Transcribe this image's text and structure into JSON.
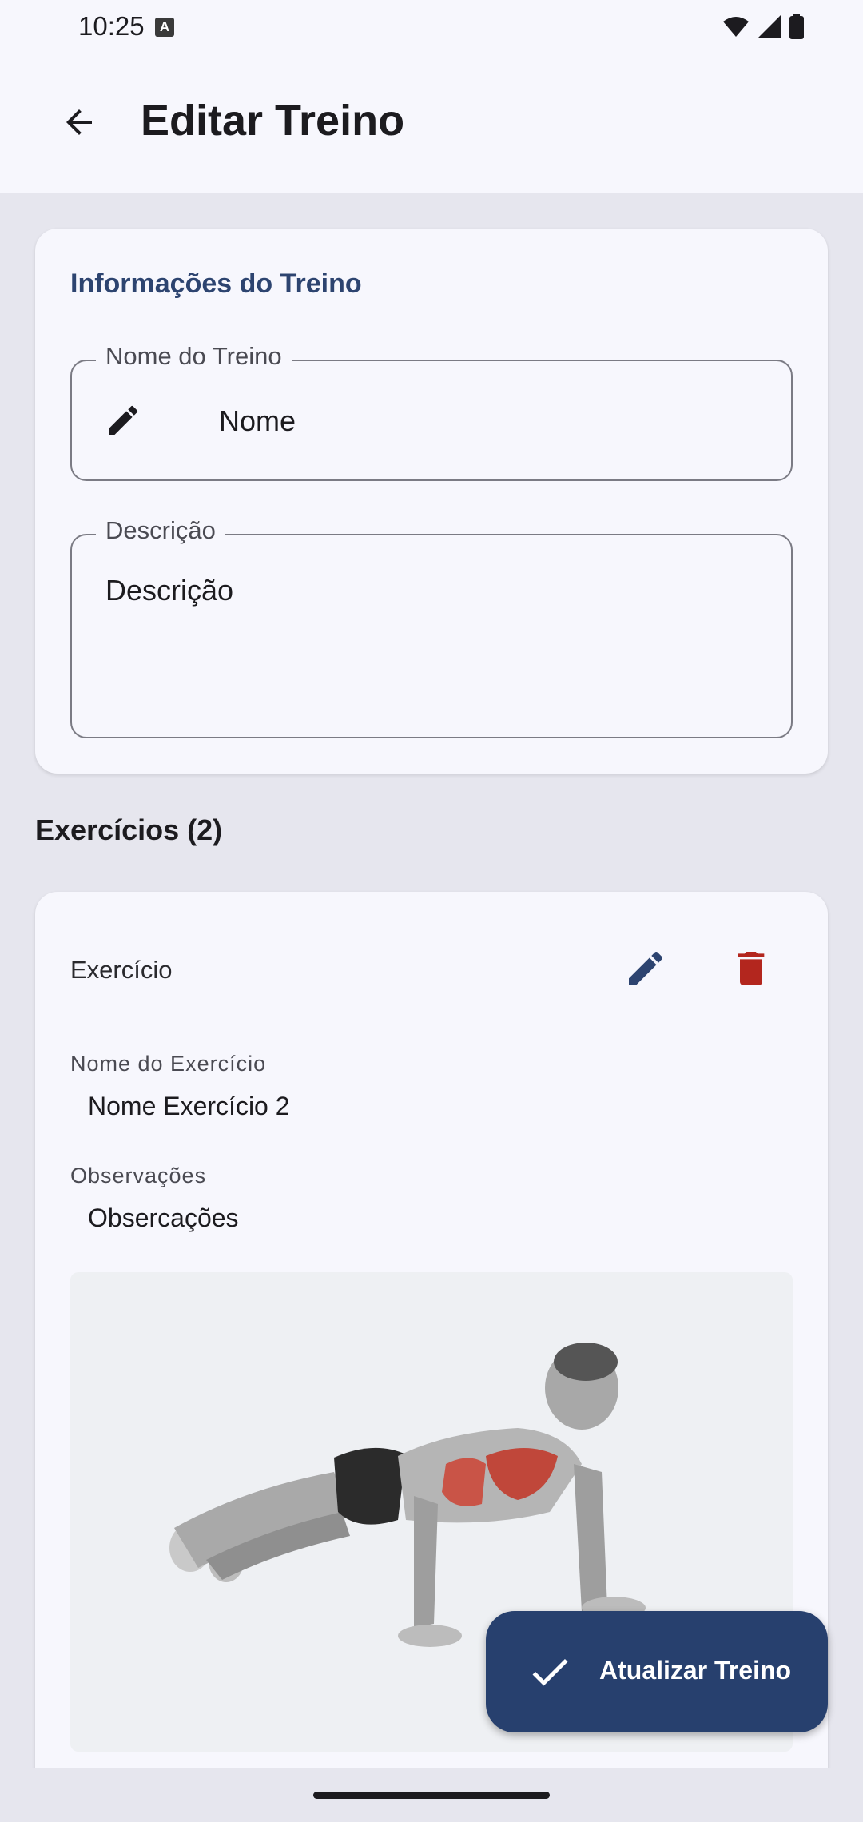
{
  "status_bar": {
    "time": "10:25",
    "notification_badge": "A",
    "icons": [
      "wifi-icon",
      "signal-icon",
      "battery-icon"
    ]
  },
  "app_bar": {
    "title": "Editar Treino",
    "back_icon": "arrow-back-icon"
  },
  "info_card": {
    "title": "Informações do Treino",
    "name_field": {
      "label": "Nome do Treino",
      "value": "Nome",
      "icon": "pencil-icon"
    },
    "description_field": {
      "label": "Descrição",
      "value": "Descrição"
    }
  },
  "exercises": {
    "heading": "Exercícios (2)",
    "items": [
      {
        "title": "Exercício",
        "name_label": "Nome do Exercício",
        "name_value": "Nome Exercício 2",
        "notes_label": "Observações",
        "notes_value": "Obsercações",
        "image": "push-up-illustration"
      }
    ]
  },
  "fab": {
    "label": "Atualizar Treino",
    "icon": "check-icon"
  },
  "colors": {
    "accent": "#27406e",
    "section_title": "#2d4470",
    "edit_icon": "#2d4470",
    "delete_icon": "#b3261e",
    "background": "#e6e6ee",
    "surface": "#f7f7fd"
  }
}
